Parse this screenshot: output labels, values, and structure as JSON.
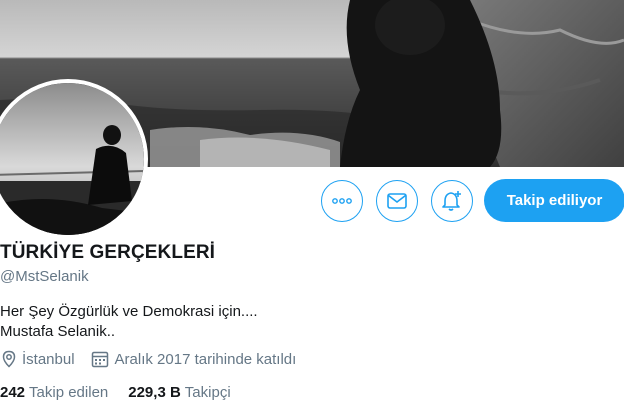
{
  "profile": {
    "name": "TÜRKİYE GERÇEKLERİ",
    "handle": "@MstSelanik",
    "bio_lines": [
      "Her Şey Özgürlük ve Demokrasi için....",
      "Mustafa Selanik.."
    ],
    "location": "İstanbul",
    "joined": "Aralık 2017 tarihinde katıldı",
    "following_count": "242",
    "following_label": "Takip edilen",
    "followers_count": "229,3 B",
    "followers_label": "Takipçi"
  },
  "actions": {
    "more_icon": "more-dots-icon",
    "message_icon": "envelope-icon",
    "notify_icon": "bell-plus-icon",
    "follow_label": "Takip ediliyor"
  },
  "colors": {
    "accent": "#1da1f2",
    "text": "#14171a",
    "muted": "#657786"
  }
}
